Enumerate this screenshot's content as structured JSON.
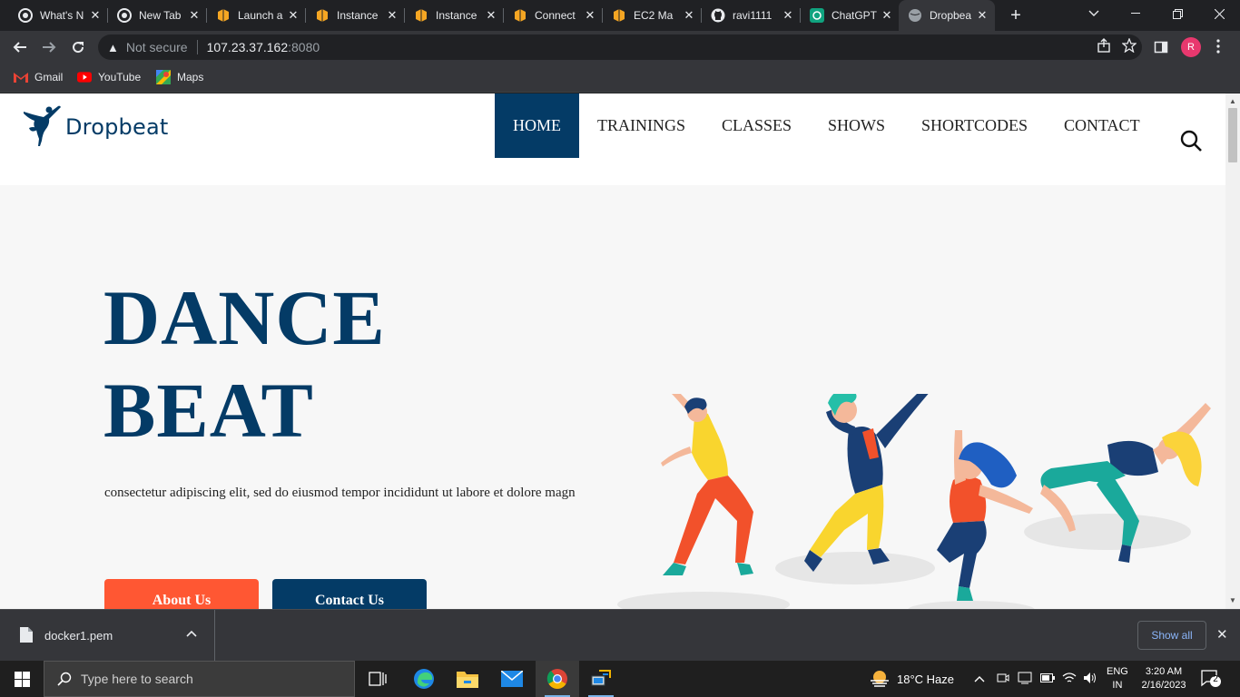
{
  "browser": {
    "tabs": [
      {
        "title": "What's N",
        "icon": "chrome-icon"
      },
      {
        "title": "New Tab",
        "icon": "chrome-icon"
      },
      {
        "title": "Launch a",
        "icon": "aws-box-icon"
      },
      {
        "title": "Instance",
        "icon": "aws-box-icon"
      },
      {
        "title": "Instance",
        "icon": "aws-box-icon"
      },
      {
        "title": "Connect",
        "icon": "aws-box-icon"
      },
      {
        "title": "EC2 Ma",
        "icon": "aws-box-icon"
      },
      {
        "title": "ravi1111",
        "icon": "github-icon"
      },
      {
        "title": "ChatGPT",
        "icon": "chatgpt-icon"
      },
      {
        "title": "Dropbea",
        "icon": "globe-icon",
        "active": true
      }
    ],
    "address": {
      "security_label": "Not secure",
      "host": "107.23.37.162",
      "port": ":8080"
    },
    "profile_initial": "R",
    "bookmarks": [
      {
        "label": "Gmail",
        "icon": "gmail-icon"
      },
      {
        "label": "YouTube",
        "icon": "youtube-icon"
      },
      {
        "label": "Maps",
        "icon": "maps-icon"
      }
    ]
  },
  "site": {
    "brand": "Dropbeat",
    "nav": [
      "HOME",
      "TRAININGS",
      "CLASSES",
      "SHOWS",
      "SHORTCODES",
      "CONTACT"
    ],
    "active_nav": "HOME",
    "hero": {
      "title_line1": "DANCE",
      "title_line2": "BEAT",
      "text": "consectetur adipiscing elit, sed do eiusmod tempor incididunt ut labore et dolore magn",
      "btn_about": "About Us",
      "btn_contact": "Contact Us"
    },
    "colors": {
      "primary": "#043b66",
      "accent": "#ff5733"
    }
  },
  "downloads": {
    "file": "docker1.pem",
    "show_all": "Show all"
  },
  "taskbar": {
    "search_placeholder": "Type here to search",
    "weather": "18°C  Haze",
    "lang_line1": "ENG",
    "lang_line2": "IN",
    "time": "3:20 AM",
    "date": "2/16/2023",
    "notifications": "2"
  }
}
